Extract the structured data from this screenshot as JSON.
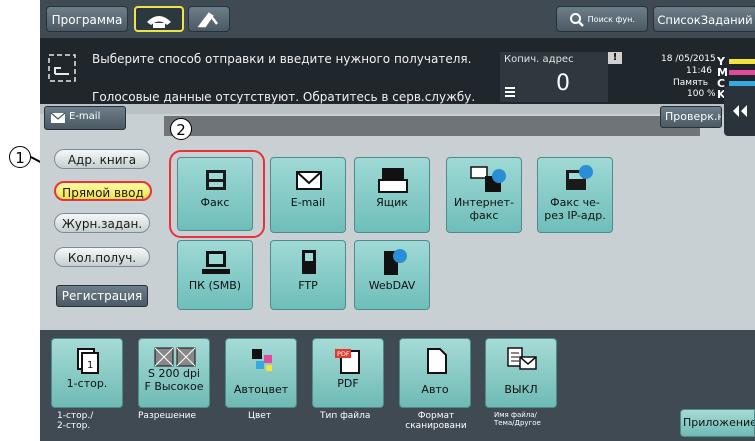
{
  "topbar": {
    "program": "Программа",
    "search": "Поиск фун.",
    "joblist": "СписокЗаданий"
  },
  "message": {
    "line1": "Выберите способ отправки и введите нужного получателя.",
    "line2": "Голосовые данные отсутствуют. Обратитесь в серв.службу.",
    "copies_label": "Копич. адрес",
    "copies_value": "0"
  },
  "status": {
    "date": "18 /05/2015",
    "time": "11:46",
    "memory_label": "Память",
    "memory_value": "100 %",
    "toner": [
      "Y",
      "M",
      "C",
      "K"
    ]
  },
  "email_tab": "E-mail",
  "check_btn": "Проверк.на",
  "sidebar": [
    "Адр. книга",
    "Прямой ввод",
    "Журн.задан.",
    "Кол.получ."
  ],
  "register_btn": "Регистрация",
  "tiles_row1": [
    {
      "label": "Факс",
      "icon": "fax-icon"
    },
    {
      "label": "E-mail",
      "icon": "email-icon"
    },
    {
      "label": "Ящик",
      "icon": "box-icon"
    },
    {
      "label": "Интернет-\nфакс",
      "icon": "internet-fax-icon"
    },
    {
      "label": "Факс че-\nрез IP-адр.",
      "icon": "ip-fax-icon"
    }
  ],
  "tiles_row2": [
    {
      "label": "ПК (SMB)",
      "icon": "pc-smb-icon"
    },
    {
      "label": "FTP",
      "icon": "ftp-icon"
    },
    {
      "label": "WebDAV",
      "icon": "webdav-icon"
    }
  ],
  "settings": [
    {
      "value": "1-стор.",
      "caption": "1-стор./\n2-стор."
    },
    {
      "value": "S 200 dpi\nF Высокое",
      "caption": "Разрешение"
    },
    {
      "value": "Автоцвет",
      "caption": "Цвет"
    },
    {
      "value": "PDF",
      "caption": "Тип файла"
    },
    {
      "value": "Авто",
      "caption": "Формат\nсканировани"
    },
    {
      "value": "ВЫКЛ",
      "caption": "Имя файла/\nТема/Другое"
    }
  ],
  "app_btn": "Приложение",
  "callouts": [
    "1",
    "2"
  ]
}
